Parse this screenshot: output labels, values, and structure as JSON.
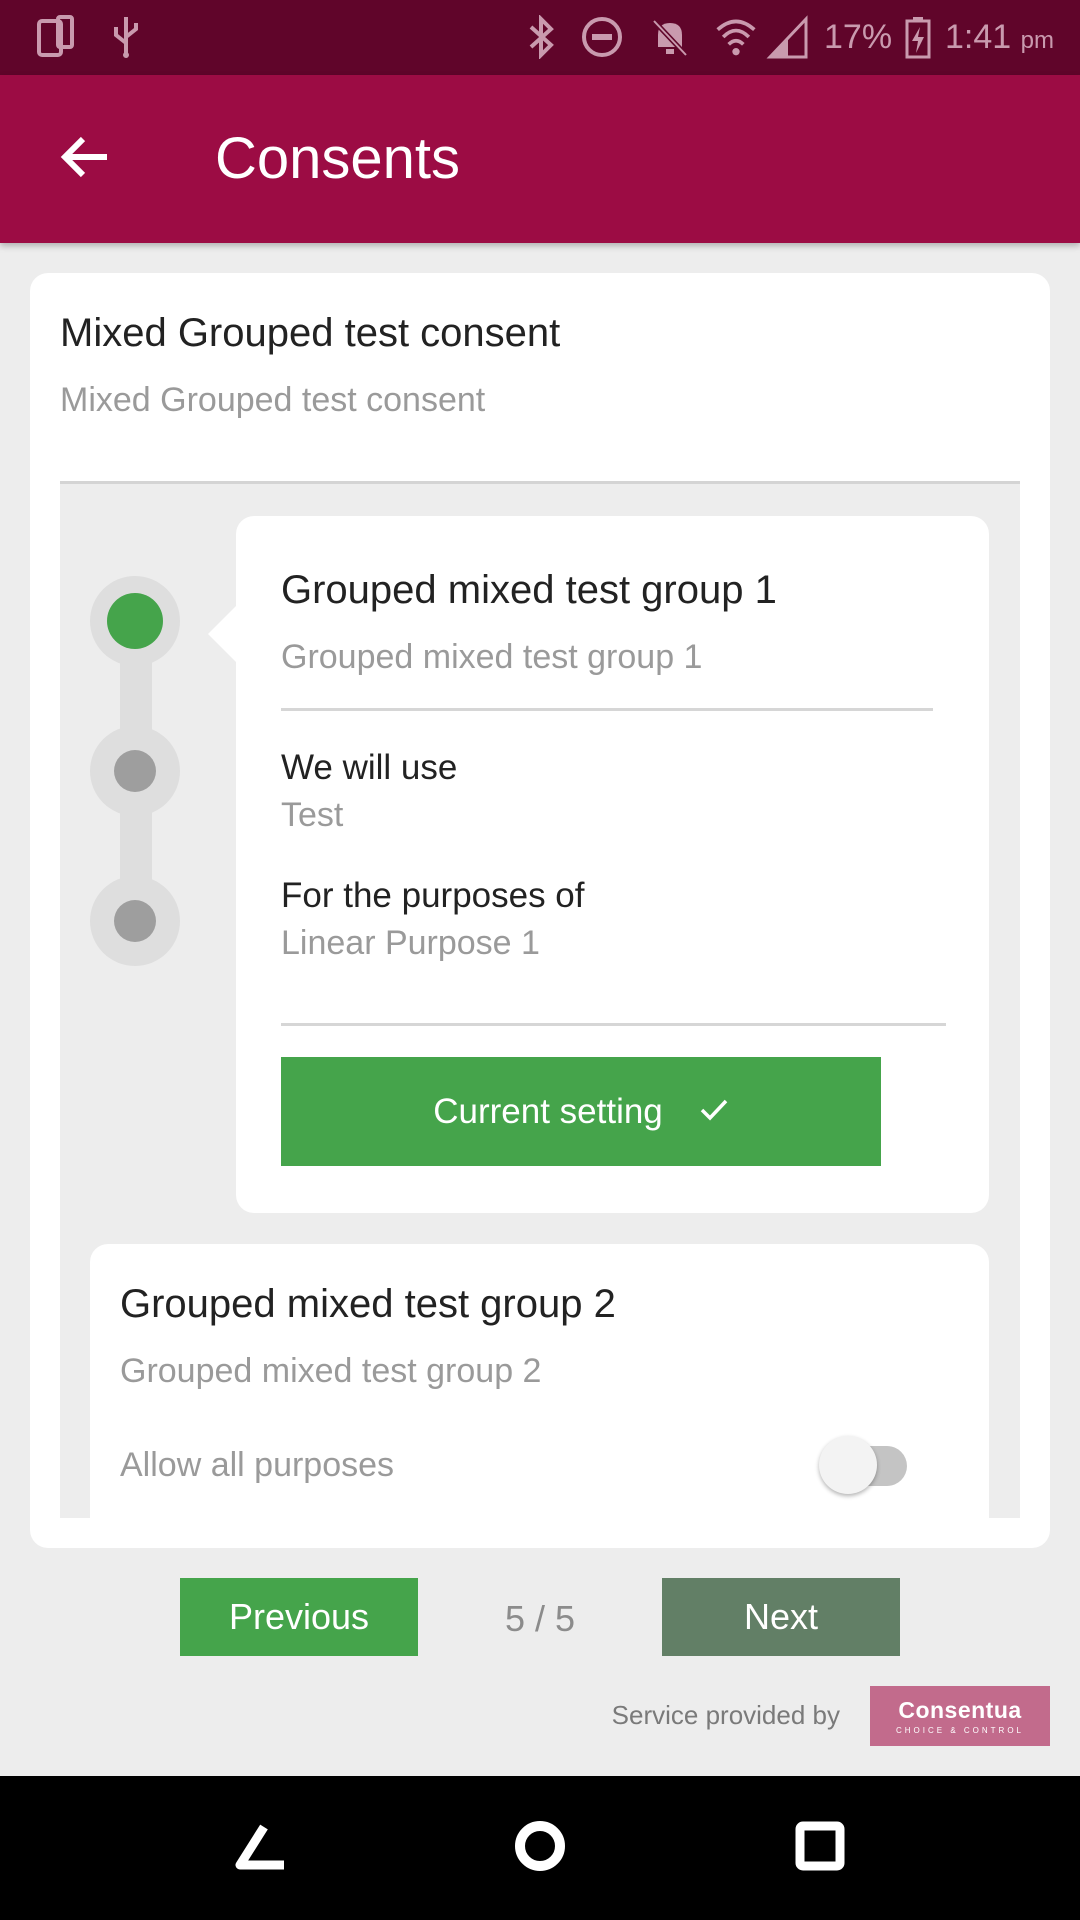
{
  "status_bar": {
    "battery_percent": "17%",
    "time": "1:41",
    "time_suffix": "pm",
    "icons": [
      "phone-icon",
      "usb-icon",
      "bluetooth-icon",
      "do-not-disturb-icon",
      "notifications-off-icon",
      "wifi-icon",
      "signal-icon",
      "battery-charging-icon"
    ]
  },
  "app_bar": {
    "title": "Consents",
    "back_icon": "arrow-back-icon"
  },
  "consent": {
    "title": "Mixed Grouped test consent",
    "subtitle": "Mixed Grouped test consent"
  },
  "group1": {
    "title": "Grouped mixed test group 1",
    "subtitle": "Grouped mixed test group 1",
    "use_label": "We will use",
    "use_value": "Test",
    "purpose_label": "For the purposes of",
    "purpose_value": "Linear Purpose 1",
    "button_label": "Current setting",
    "button_icon": "check-icon"
  },
  "group2": {
    "title": "Grouped mixed test group 2",
    "subtitle": "Grouped mixed test group 2",
    "allow_label": "Allow all purposes",
    "toggle_on": false
  },
  "stepper": {
    "steps": 3,
    "active_step": 1
  },
  "pagination": {
    "previous_label": "Previous",
    "page_indicator": "5 / 5",
    "next_label": "Next"
  },
  "footer": {
    "service_text": "Service provided by",
    "brand_name": "Consentua",
    "brand_tagline": "CHOICE & CONTROL"
  },
  "colors": {
    "status_bar": "#60052a",
    "app_bar": "#9c0c44",
    "accent_green": "#45a44b",
    "next_button": "#627f66",
    "brand_logo": "#c26b8c"
  }
}
